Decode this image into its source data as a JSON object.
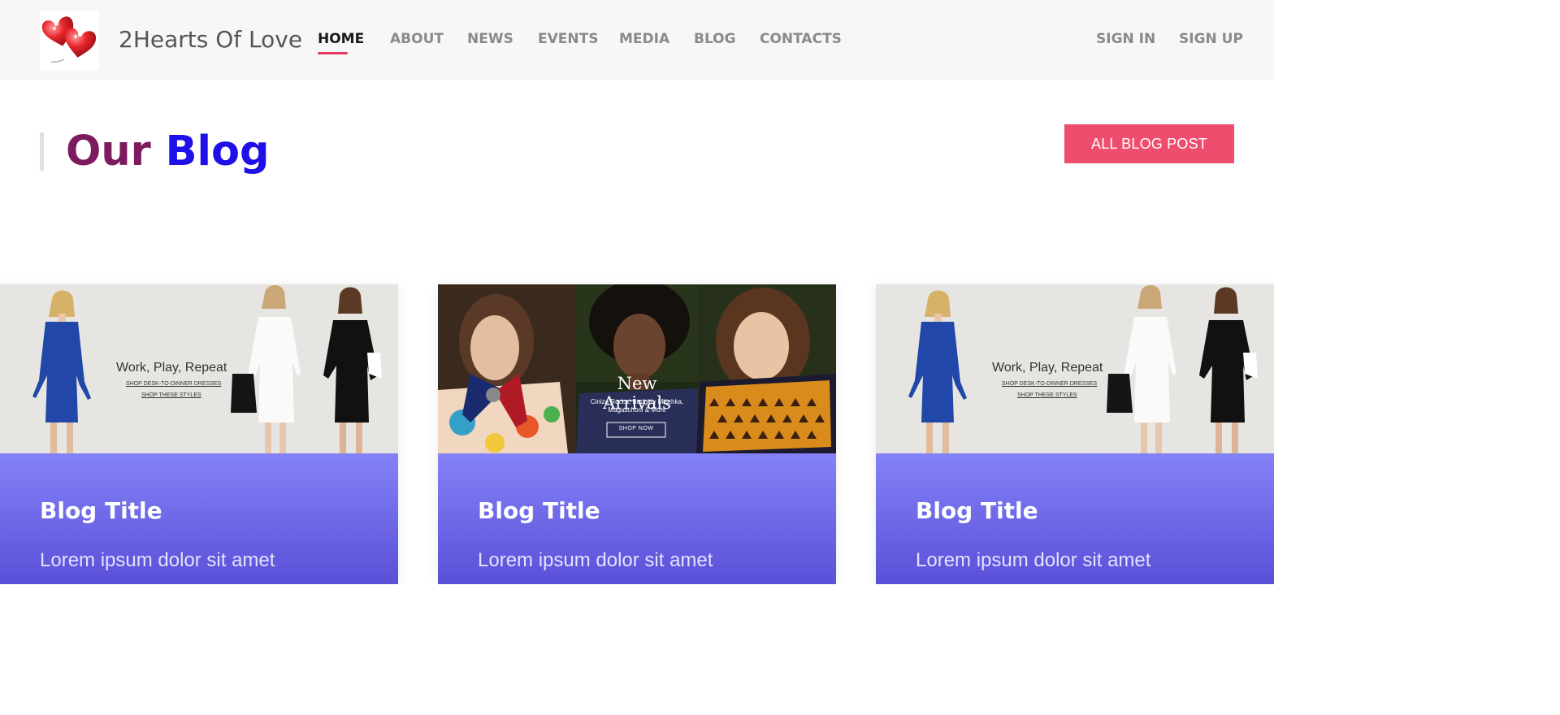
{
  "header": {
    "brand": "2Hearts Of Love",
    "logo_icon": "hearts-logo-icon",
    "nav": [
      "HOME",
      "ABOUT",
      "NEWS",
      "EVENTS",
      "MEDIA",
      "BLOG",
      "CONTACTS"
    ],
    "active_nav": "HOME",
    "auth": [
      "SIGN IN",
      "SIGN UP"
    ],
    "accent_color": "#e53960"
  },
  "section": {
    "title_part1": "Our",
    "title_part2": "Blog",
    "title_color1": "#7c1b5e",
    "title_color2": "#1e10e6",
    "button_label": "ALL BLOG POST",
    "button_color": "#ef4d6d"
  },
  "cards": [
    {
      "image": {
        "headline": "Work, Play, Repeat",
        "link1": "SHOP DESK-TO-DINNER DRESSES",
        "link2": "SHOP THESE STYLES"
      },
      "title": "Blog Title",
      "text": "Lorem ipsum dolor sit amet"
    },
    {
      "image": {
        "headline": "New Arrivals",
        "sub1": "Ciniza Rocca, Badgley Mischka,",
        "sub2": "Magaschoni & More",
        "cta": "SHOP NOW"
      },
      "title": "Blog Title",
      "text": "Lorem ipsum dolor sit amet"
    },
    {
      "image": {
        "headline": "Work, Play, Repeat",
        "link1": "SHOP DESK-TO-DINNER DRESSES",
        "link2": "SHOP THESE STYLES"
      },
      "title": "Blog Title",
      "text": "Lorem ipsum dolor sit amet"
    }
  ]
}
